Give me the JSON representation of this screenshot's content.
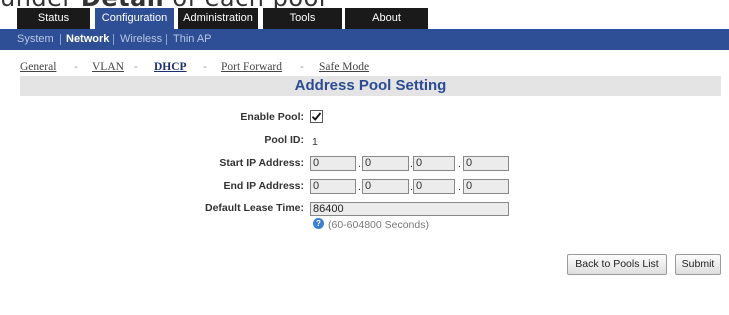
{
  "top_crop_text": {
    "prefix": "under ",
    "bold": "Detail",
    "suffix": " of each pool"
  },
  "tabs": [
    {
      "label": "Status",
      "active": false
    },
    {
      "label": "Configuration",
      "active": true
    },
    {
      "label": "Administration",
      "active": false
    },
    {
      "label": "Tools",
      "active": false
    },
    {
      "label": "About",
      "active": false
    }
  ],
  "subnav": [
    {
      "label": "System",
      "active": false
    },
    {
      "label": "Network",
      "active": true
    },
    {
      "label": "Wireless",
      "active": false
    },
    {
      "label": "Thin AP",
      "active": false
    }
  ],
  "breadcrumbs": [
    {
      "label": "General",
      "active": false
    },
    {
      "label": "VLAN",
      "active": false
    },
    {
      "label": "DHCP",
      "active": true
    },
    {
      "label": "Port Forward",
      "active": false
    },
    {
      "label": "Safe Mode",
      "active": false
    }
  ],
  "breadcrumb_separator": "-",
  "page_title": "Address Pool Setting",
  "form": {
    "enable_pool_label": "Enable Pool:",
    "enable_pool_checked": true,
    "pool_id_label": "Pool ID:",
    "pool_id_value": "1",
    "start_ip_label": "Start IP Address:",
    "start_ip": [
      "0",
      "0",
      "0",
      "0"
    ],
    "end_ip_label": "End IP Address:",
    "end_ip": [
      "0",
      "0",
      "0",
      "0"
    ],
    "ip_separator": ".",
    "lease_label": "Default Lease Time:",
    "lease_value": "86400",
    "lease_hint": "(60-604800 Seconds)"
  },
  "buttons": {
    "back_label": "Back to Pools List",
    "submit_label": "Submit"
  },
  "colors": {
    "nav_blue": "#2e4f95",
    "tab_dark": "#1a1a1a",
    "title_text": "#2b4c94"
  },
  "icons": {
    "help": "question-circle-icon",
    "checkbox": "checkmark-icon"
  }
}
